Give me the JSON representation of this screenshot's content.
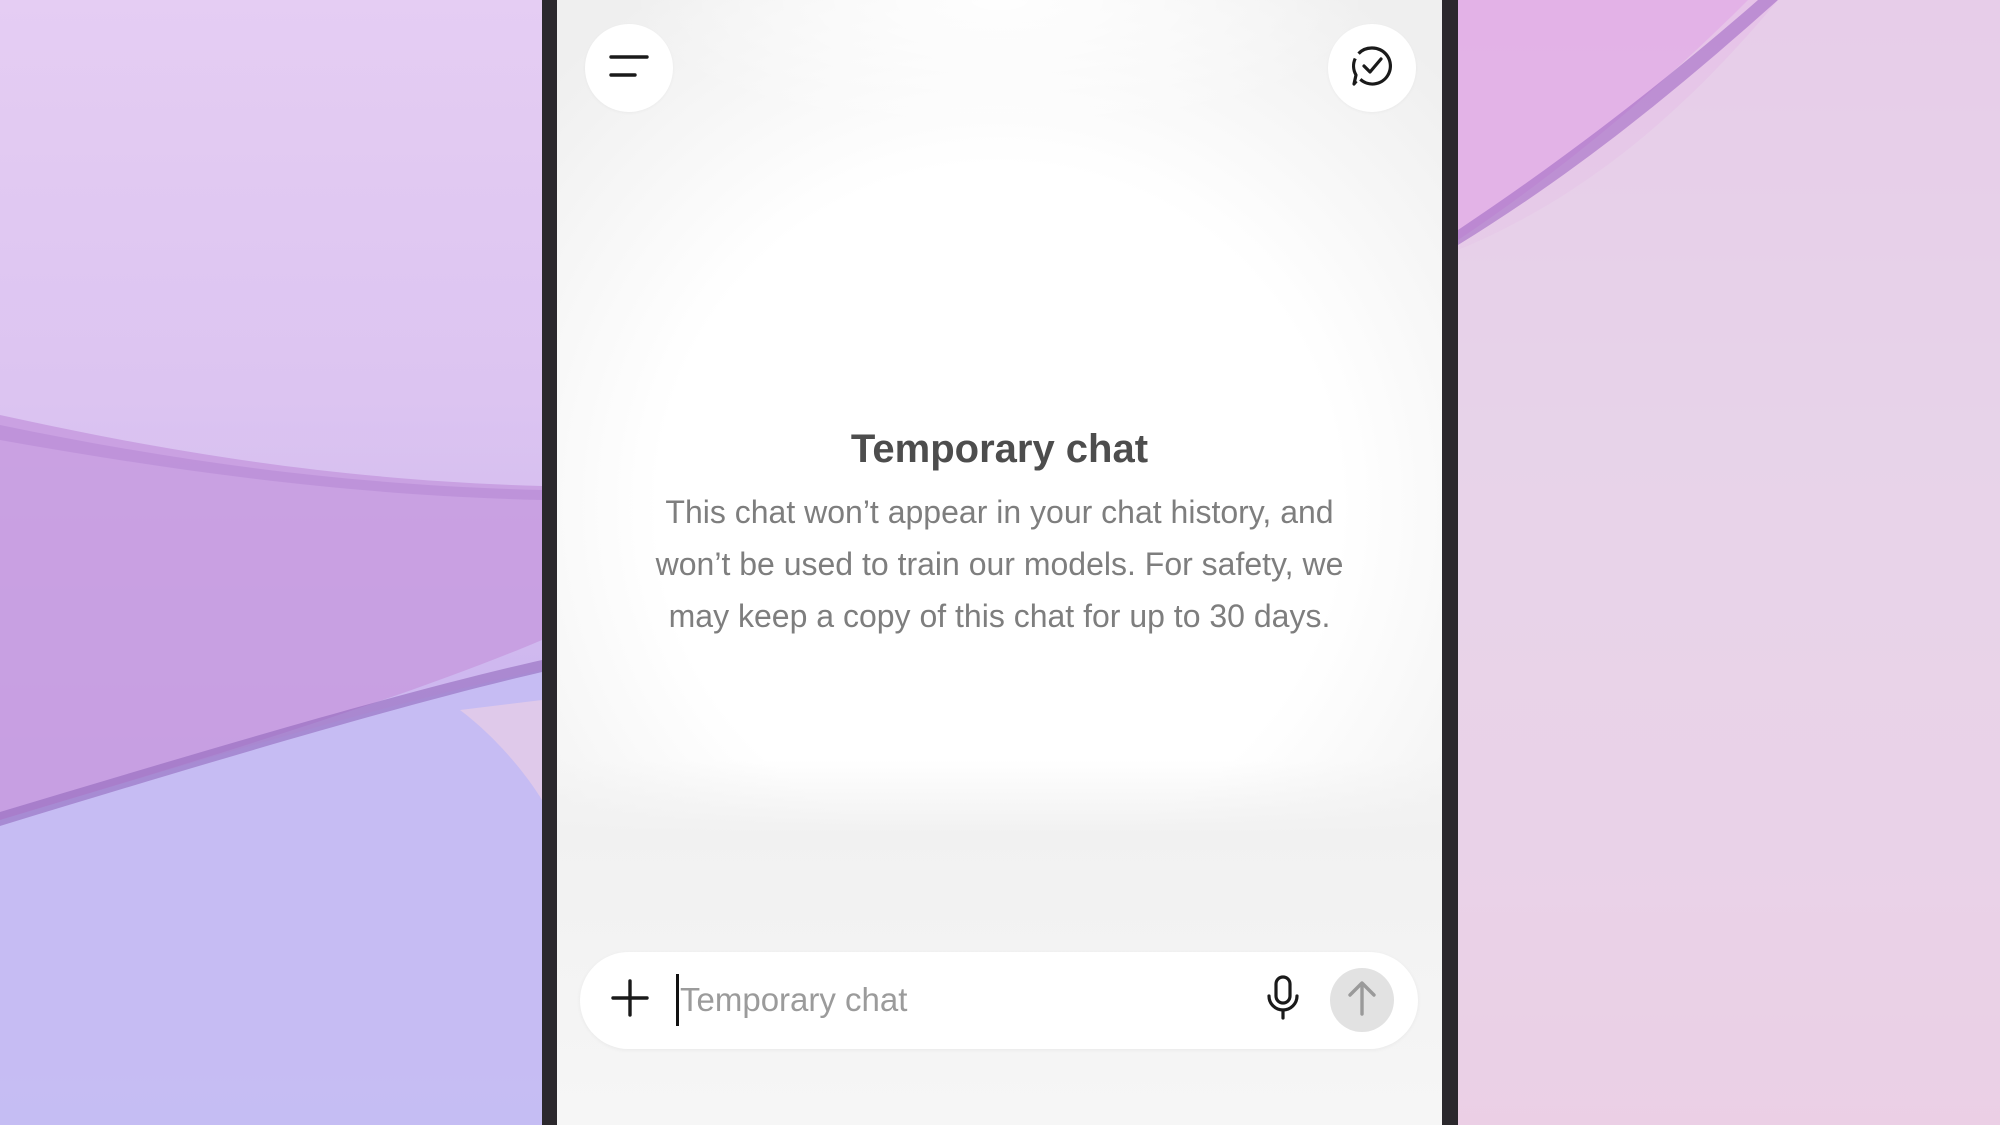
{
  "window": {
    "app": "ChatGPT"
  },
  "header": {
    "menu_icon": "menu-lines-icon",
    "temporary_chat_icon": "chat-check-icon"
  },
  "notice": {
    "title": "Temporary chat",
    "description": "This chat won’t appear in your chat history, and won’t be used to train our models. For safety, we may keep a copy of this chat for up to 30 days."
  },
  "composer": {
    "value": "",
    "placeholder": "Temporary chat",
    "attach_icon": "plus-icon",
    "mic_icon": "microphone-icon",
    "send_icon": "arrow-up-icon"
  },
  "colors": {
    "title": "#4d4d4d",
    "description": "#7e7e7e",
    "placeholder": "#9b9b9b",
    "send_button_bg": "#e2e2e2",
    "bezel": "#2b282d"
  }
}
